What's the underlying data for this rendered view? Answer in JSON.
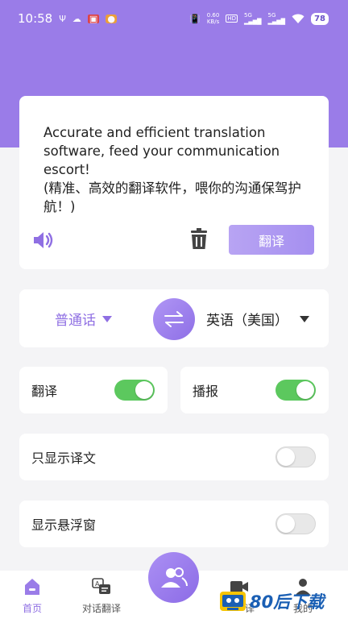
{
  "status_bar": {
    "time": "10:58",
    "left_icons": [
      "usb-icon",
      "cloud-icon",
      "app-notification-icon",
      "app-notification-icon"
    ],
    "speed_value": "0.60",
    "speed_unit": "KB/s",
    "hd_label": "HD",
    "net1": "5G",
    "net2": "5G",
    "battery": "78"
  },
  "input_card": {
    "text_en": "Accurate and efficient translation software, feed your communication escort!",
    "text_zh": "(精准、高效的翻译软件，喂你的沟通保驾护航！)",
    "translate_button": "翻译"
  },
  "language_bar": {
    "source_language": "普通话",
    "target_language": "英语（美国）"
  },
  "settings": {
    "translate_label": "翻译",
    "translate_on": true,
    "broadcast_label": "播报",
    "broadcast_on": true,
    "only_translation_label": "只显示译文",
    "only_translation_on": false,
    "floating_window_label": "显示悬浮窗",
    "floating_window_on": false
  },
  "tabbar": {
    "home": "首页",
    "dialog_translate": "对话翻译",
    "video_translate_partial": "译",
    "mine_partial": "我的"
  },
  "watermark": {
    "text": "80后下载"
  },
  "colors": {
    "primary": "#9a7ce8",
    "accent_text": "#8f6fe3",
    "switch_on": "#5cc85e",
    "background": "#f4f4f6"
  }
}
